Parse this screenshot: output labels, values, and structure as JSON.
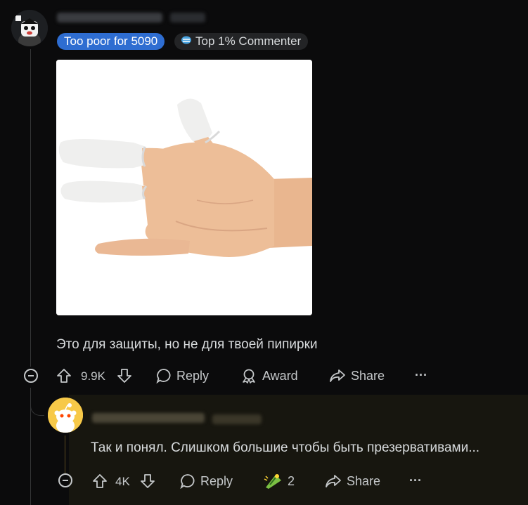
{
  "comment": {
    "flairs": {
      "primary": "Too poor for 5090",
      "secondary": "Top 1% Commenter"
    },
    "image_alt": "hand wearing finger cots",
    "text": "Это для защиты, но не для твоей пипирки",
    "actions": {
      "score": "9.9K",
      "reply": "Reply",
      "award": "Award",
      "share": "Share",
      "more": "···"
    }
  },
  "reply": {
    "text": "Так и понял. Слишком большие чтобы быть презервативами...",
    "actions": {
      "score": "4K",
      "reply": "Reply",
      "award_count": "2",
      "share": "Share",
      "more": "···"
    }
  },
  "colors": {
    "background": "#0b0b0c",
    "flair_blue": "#2e6dd1",
    "reply_background": "#17160f",
    "snoo_yellow": "#f7c948"
  }
}
